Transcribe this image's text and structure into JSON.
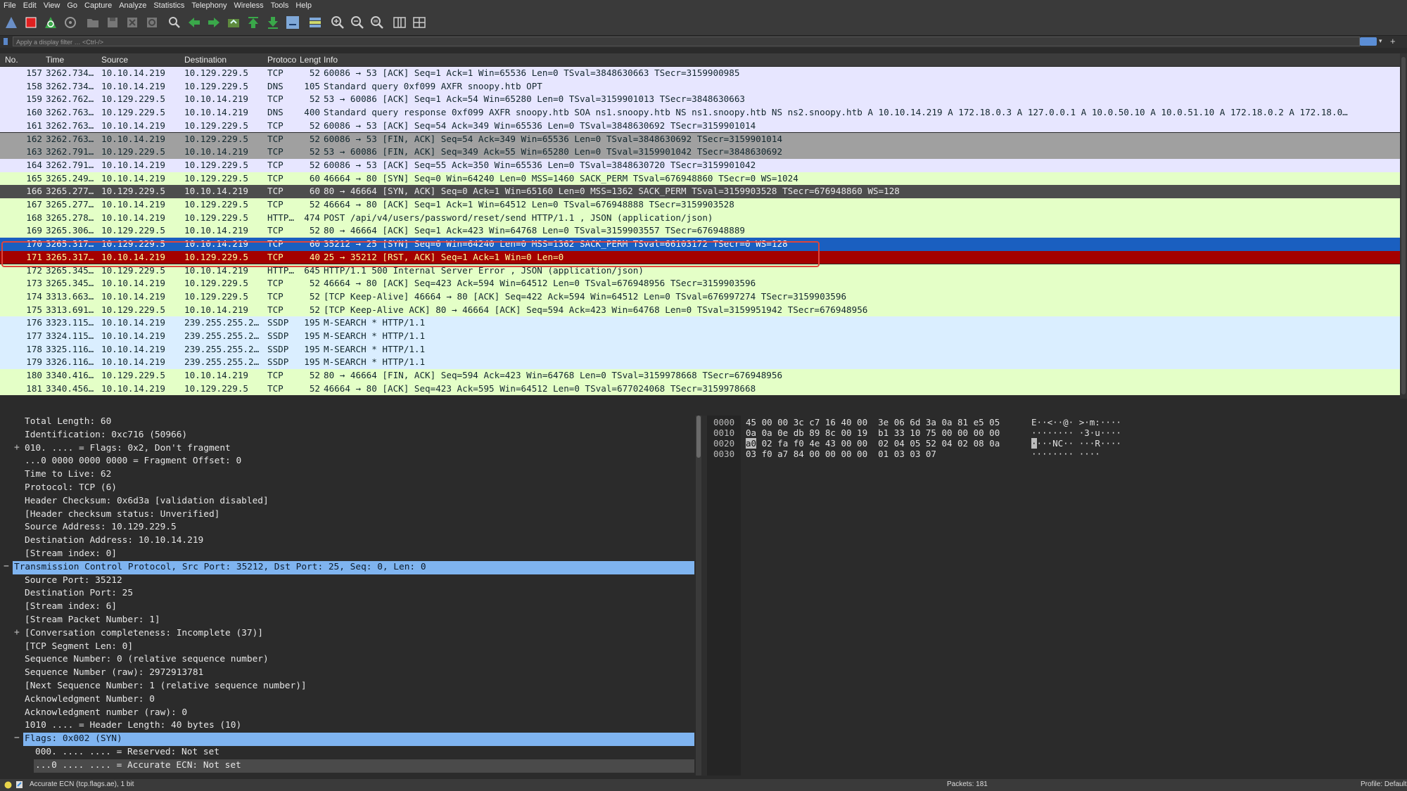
{
  "menu": [
    "File",
    "Edit",
    "View",
    "Go",
    "Capture",
    "Analyze",
    "Statistics",
    "Telephony",
    "Wireless",
    "Tools",
    "Help"
  ],
  "filter": {
    "placeholder": "Apply a display filter … <Ctrl-/>"
  },
  "columns": [
    "No.",
    "Time",
    "Source",
    "Destination",
    "Protocol",
    "Length",
    "Info"
  ],
  "packets": [
    {
      "no": "157",
      "time": "3262.734…",
      "src": "10.10.14.219",
      "dst": "10.129.229.5",
      "proto": "TCP",
      "len": "52",
      "info": "60086 → 53 [ACK] Seq=1 Ack=1 Win=65536 Len=0 TSval=3848630663 TSecr=3159900985",
      "bg": "#e7e6ff"
    },
    {
      "no": "158",
      "time": "3262.734…",
      "src": "10.10.14.219",
      "dst": "10.129.229.5",
      "proto": "DNS",
      "len": "105",
      "info": "Standard query 0xf099 AXFR snoopy.htb OPT",
      "bg": "#e7e6ff"
    },
    {
      "no": "159",
      "time": "3262.762…",
      "src": "10.129.229.5",
      "dst": "10.10.14.219",
      "proto": "TCP",
      "len": "52",
      "info": "53 → 60086 [ACK] Seq=1 Ack=54 Win=65280 Len=0 TSval=3159901013 TSecr=3848630663",
      "bg": "#e7e6ff"
    },
    {
      "no": "160",
      "time": "3262.763…",
      "src": "10.129.229.5",
      "dst": "10.10.14.219",
      "proto": "DNS",
      "len": "400",
      "info": "Standard query response 0xf099 AXFR snoopy.htb SOA ns1.snoopy.htb NS ns1.snoopy.htb NS ns2.snoopy.htb A 10.10.14.219 A 172.18.0.3 A 127.0.0.1 A 10.0.50.10 A 10.0.51.10 A 172.18.0.2 A 172.18.0…",
      "bg": "#e7e6ff"
    },
    {
      "no": "161",
      "time": "3262.763…",
      "src": "10.10.14.219",
      "dst": "10.129.229.5",
      "proto": "TCP",
      "len": "52",
      "info": "60086 → 53 [ACK] Seq=54 Ack=349 Win=65536 Len=0 TSval=3848630692 TSecr=3159901014",
      "bg": "#e7e6ff"
    },
    {
      "no": "162",
      "time": "3262.763…",
      "src": "10.10.14.219",
      "dst": "10.129.229.5",
      "proto": "TCP",
      "len": "52",
      "info": "60086 → 53 [FIN, ACK] Seq=54 Ack=349 Win=65536 Len=0 TSval=3848630692 TSecr=3159901014",
      "bg": "#a0a0a0"
    },
    {
      "no": "163",
      "time": "3262.791…",
      "src": "10.129.229.5",
      "dst": "10.10.14.219",
      "proto": "TCP",
      "len": "52",
      "info": "53 → 60086 [FIN, ACK] Seq=349 Ack=55 Win=65280 Len=0 TSval=3159901042 TSecr=3848630692",
      "bg": "#a0a0a0"
    },
    {
      "no": "164",
      "time": "3262.791…",
      "src": "10.10.14.219",
      "dst": "10.129.229.5",
      "proto": "TCP",
      "len": "52",
      "info": "60086 → 53 [ACK] Seq=55 Ack=350 Win=65536 Len=0 TSval=3848630720 TSecr=3159901042",
      "bg": "#e7e6ff"
    },
    {
      "no": "165",
      "time": "3265.249…",
      "src": "10.10.14.219",
      "dst": "10.129.229.5",
      "proto": "TCP",
      "len": "60",
      "info": "46664 → 80 [SYN] Seq=0 Win=64240 Len=0 MSS=1460 SACK_PERM TSval=676948860 TSecr=0 WS=1024",
      "bg": "#e4ffc7"
    },
    {
      "no": "166",
      "time": "3265.277…",
      "src": "10.129.229.5",
      "dst": "10.10.14.219",
      "proto": "TCP",
      "len": "60",
      "info": "80 → 46664 [SYN, ACK] Seq=0 Ack=1 Win=65160 Len=0 MSS=1362 SACK_PERM TSval=3159903528 TSecr=676948860 WS=128",
      "bg": "#4d4d4d",
      "fg": "#e8e8e8"
    },
    {
      "no": "167",
      "time": "3265.277…",
      "src": "10.10.14.219",
      "dst": "10.129.229.5",
      "proto": "TCP",
      "len": "52",
      "info": "46664 → 80 [ACK] Seq=1 Ack=1 Win=64512 Len=0 TSval=676948888 TSecr=3159903528",
      "bg": "#e4ffc7"
    },
    {
      "no": "168",
      "time": "3265.278…",
      "src": "10.10.14.219",
      "dst": "10.129.229.5",
      "proto": "HTTP…",
      "len": "474",
      "info": "POST /api/v4/users/password/reset/send HTTP/1.1 , JSON (application/json)",
      "bg": "#e4ffc7"
    },
    {
      "no": "169",
      "time": "3265.306…",
      "src": "10.129.229.5",
      "dst": "10.10.14.219",
      "proto": "TCP",
      "len": "52",
      "info": "80 → 46664 [ACK] Seq=1 Ack=423 Win=64768 Len=0 TSval=3159903557 TSecr=676948889",
      "bg": "#e4ffc7"
    },
    {
      "no": "170",
      "time": "3265.317…",
      "src": "10.129.229.5",
      "dst": "10.10.14.219",
      "proto": "TCP",
      "len": "60",
      "info": "35212 → 25 [SYN] Seq=0 Win=64240 Len=0 MSS=1362 SACK_PERM TSval=66103172 TSecr=0 WS=128",
      "bg": "#1a5fc0",
      "fg": "#ffffff"
    },
    {
      "no": "171",
      "time": "3265.317…",
      "src": "10.10.14.219",
      "dst": "10.129.229.5",
      "proto": "TCP",
      "len": "40",
      "info": "25 → 35212 [RST, ACK] Seq=1 Ack=1 Win=0 Len=0",
      "bg": "#a40000",
      "fg": "#fffc9c"
    },
    {
      "no": "172",
      "time": "3265.345…",
      "src": "10.129.229.5",
      "dst": "10.10.14.219",
      "proto": "HTTP…",
      "len": "645",
      "info": "HTTP/1.1 500 Internal Server Error , JSON (application/json)",
      "bg": "#e4ffc7"
    },
    {
      "no": "173",
      "time": "3265.345…",
      "src": "10.10.14.219",
      "dst": "10.129.229.5",
      "proto": "TCP",
      "len": "52",
      "info": "46664 → 80 [ACK] Seq=423 Ack=594 Win=64512 Len=0 TSval=676948956 TSecr=3159903596",
      "bg": "#e4ffc7"
    },
    {
      "no": "174",
      "time": "3313.663…",
      "src": "10.10.14.219",
      "dst": "10.129.229.5",
      "proto": "TCP",
      "len": "52",
      "info": "[TCP Keep-Alive] 46664 → 80 [ACK] Seq=422 Ack=594 Win=64512 Len=0 TSval=676997274 TSecr=3159903596",
      "bg": "#e4ffc7"
    },
    {
      "no": "175",
      "time": "3313.691…",
      "src": "10.129.229.5",
      "dst": "10.10.14.219",
      "proto": "TCP",
      "len": "52",
      "info": "[TCP Keep-Alive ACK] 80 → 46664 [ACK] Seq=594 Ack=423 Win=64768 Len=0 TSval=3159951942 TSecr=676948956",
      "bg": "#e4ffc7"
    },
    {
      "no": "176",
      "time": "3323.115…",
      "src": "10.10.14.219",
      "dst": "239.255.255.2…",
      "proto": "SSDP",
      "len": "195",
      "info": "M-SEARCH * HTTP/1.1",
      "bg": "#daeeff"
    },
    {
      "no": "177",
      "time": "3324.115…",
      "src": "10.10.14.219",
      "dst": "239.255.255.2…",
      "proto": "SSDP",
      "len": "195",
      "info": "M-SEARCH * HTTP/1.1",
      "bg": "#daeeff"
    },
    {
      "no": "178",
      "time": "3325.116…",
      "src": "10.10.14.219",
      "dst": "239.255.255.2…",
      "proto": "SSDP",
      "len": "195",
      "info": "M-SEARCH * HTTP/1.1",
      "bg": "#daeeff"
    },
    {
      "no": "179",
      "time": "3326.116…",
      "src": "10.10.14.219",
      "dst": "239.255.255.2…",
      "proto": "SSDP",
      "len": "195",
      "info": "M-SEARCH * HTTP/1.1",
      "bg": "#daeeff"
    },
    {
      "no": "180",
      "time": "3340.416…",
      "src": "10.129.229.5",
      "dst": "10.10.14.219",
      "proto": "TCP",
      "len": "52",
      "info": "80 → 46664 [FIN, ACK] Seq=594 Ack=423 Win=64768 Len=0 TSval=3159978668 TSecr=676948956",
      "bg": "#e4ffc7"
    },
    {
      "no": "181",
      "time": "3340.456…",
      "src": "10.10.14.219",
      "dst": "10.129.229.5",
      "proto": "TCP",
      "len": "52",
      "info": "46664 → 80 [ACK] Seq=423 Ack=595 Win=64512 Len=0 TSval=677024068 TSecr=3159978668",
      "bg": "#e4ffc7"
    }
  ],
  "details": [
    {
      "text": "Total Length: 60",
      "indent": 2,
      "exp": "",
      "state": ""
    },
    {
      "text": "Identification: 0xc716 (50966)",
      "indent": 2,
      "exp": "",
      "state": ""
    },
    {
      "text": "010. .... = Flags: 0x2, Don't fragment",
      "indent": 2,
      "exp": "+",
      "state": ""
    },
    {
      "text": "...0 0000 0000 0000 = Fragment Offset: 0",
      "indent": 2,
      "exp": "",
      "state": ""
    },
    {
      "text": "Time to Live: 62",
      "indent": 2,
      "exp": "",
      "state": ""
    },
    {
      "text": "Protocol: TCP (6)",
      "indent": 2,
      "exp": "",
      "state": ""
    },
    {
      "text": "Header Checksum: 0x6d3a [validation disabled]",
      "indent": 2,
      "exp": "",
      "state": ""
    },
    {
      "text": "[Header checksum status: Unverified]",
      "indent": 2,
      "exp": "",
      "state": ""
    },
    {
      "text": "Source Address: 10.129.229.5",
      "indent": 2,
      "exp": "",
      "state": ""
    },
    {
      "text": "Destination Address: 10.10.14.219",
      "indent": 2,
      "exp": "",
      "state": ""
    },
    {
      "text": "[Stream index: 0]",
      "indent": 2,
      "exp": "",
      "state": ""
    },
    {
      "text": "Transmission Control Protocol, Src Port: 35212, Dst Port: 25, Seq: 0, Len: 0",
      "indent": 1,
      "exp": "−",
      "state": "sel"
    },
    {
      "text": "Source Port: 35212",
      "indent": 2,
      "exp": "",
      "state": ""
    },
    {
      "text": "Destination Port: 25",
      "indent": 2,
      "exp": "",
      "state": ""
    },
    {
      "text": "[Stream index: 6]",
      "indent": 2,
      "exp": "",
      "state": ""
    },
    {
      "text": "[Stream Packet Number: 1]",
      "indent": 2,
      "exp": "",
      "state": ""
    },
    {
      "text": "[Conversation completeness: Incomplete (37)]",
      "indent": 2,
      "exp": "+",
      "state": ""
    },
    {
      "text": "[TCP Segment Len: 0]",
      "indent": 2,
      "exp": "",
      "state": ""
    },
    {
      "text": "Sequence Number: 0    (relative sequence number)",
      "indent": 2,
      "exp": "",
      "state": ""
    },
    {
      "text": "Sequence Number (raw): 2972913781",
      "indent": 2,
      "exp": "",
      "state": ""
    },
    {
      "text": "[Next Sequence Number: 1    (relative sequence number)]",
      "indent": 2,
      "exp": "",
      "state": ""
    },
    {
      "text": "Acknowledgment Number: 0",
      "indent": 2,
      "exp": "",
      "state": ""
    },
    {
      "text": "Acknowledgment number (raw): 0",
      "indent": 2,
      "exp": "",
      "state": ""
    },
    {
      "text": "1010 .... = Header Length: 40 bytes (10)",
      "indent": 2,
      "exp": "",
      "state": ""
    },
    {
      "text": "Flags: 0x002 (SYN)",
      "indent": 2,
      "exp": "−",
      "state": "sel"
    },
    {
      "text": "000. .... .... = Reserved: Not set",
      "indent": 3,
      "exp": "",
      "state": ""
    },
    {
      "text": "...0 .... .... = Accurate ECN: Not set",
      "indent": 3,
      "exp": "",
      "state": "hover"
    }
  ],
  "bytes": [
    {
      "off": "0000",
      "hex": "45 00 00 3c c7 16 40 00  3e 06 6d 3a 0a 81 e5 05",
      "ascii": "E··<··@· >·m:····"
    },
    {
      "off": "0010",
      "hex": "0a 0a 0e db 89 8c 00 19  b1 33 10 75 00 00 00 00",
      "ascii": "········ ·3·u····"
    },
    {
      "off": "0020",
      "hex_hl": "a0",
      "hex_rest": " 02 fa f0 4e 43 00 00  02 04 05 52 04 02 08 0a",
      "ascii_hl": "·",
      "ascii_rest": "···NC·· ···R····"
    },
    {
      "off": "0030",
      "hex": "03 f0 a7 84 00 00 00 00  01 03 03 07",
      "ascii": "········ ····"
    }
  ],
  "status": {
    "field": "Accurate ECN (tcp.flags.ae), 1 bit",
    "packets": "Packets: 181",
    "profile": "Profile: Default"
  }
}
